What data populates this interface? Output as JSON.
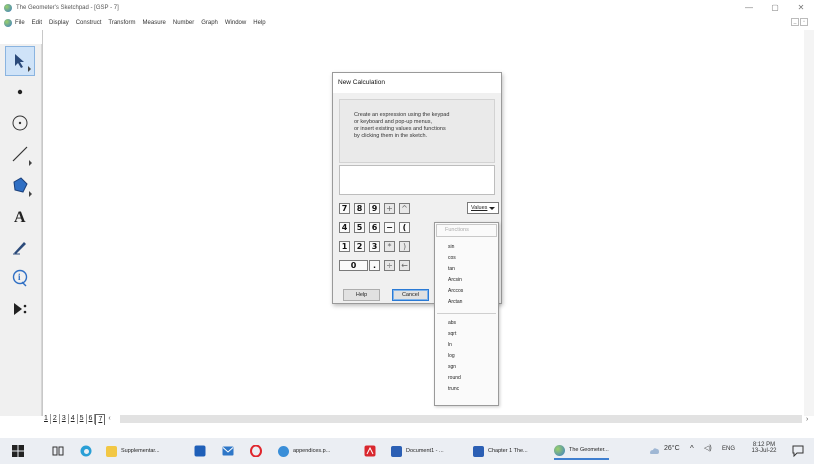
{
  "window": {
    "title": "The Geometer's Sketchpad - [GSP - 7]",
    "minimize": "—",
    "maximize": "▢",
    "close": "✕"
  },
  "menubar": {
    "items": [
      "File",
      "Edit",
      "Display",
      "Construct",
      "Transform",
      "Measure",
      "Number",
      "Graph",
      "Window",
      "Help"
    ]
  },
  "toolbox": {
    "tools": [
      "selection-arrow",
      "point",
      "compass",
      "straightedge",
      "polygon",
      "text",
      "marker",
      "information",
      "custom"
    ]
  },
  "dialog": {
    "title": "New Calculation",
    "instructions": [
      "Create an expression using the keypad",
      "or keyboard and pop-up menus,",
      "or insert existing values and functions",
      "by clicking them in the sketch."
    ],
    "keypad": {
      "row1": [
        "7",
        "8",
        "9",
        "+",
        "^"
      ],
      "row2": [
        "4",
        "5",
        "6",
        "−",
        "("
      ],
      "row3": [
        "1",
        "2",
        "3",
        "*",
        ")"
      ],
      "row4": [
        "0",
        ".",
        "÷",
        "←"
      ]
    },
    "values_label": "Values",
    "help_label": "Help",
    "cancel_label": "Cancel"
  },
  "functions_menu": {
    "header": "Functions",
    "group1": [
      "sin",
      "cos",
      "tan",
      "Arcsin",
      "Arccos",
      "Arctan"
    ],
    "group2": [
      "abs",
      "sqrt",
      "ln",
      "log",
      "sgn",
      "round",
      "trunc"
    ]
  },
  "pages": {
    "tabs": [
      "1",
      "2",
      "3",
      "4",
      "5",
      "6",
      "7"
    ],
    "current": "7"
  },
  "taskbar": {
    "apps": [
      {
        "label": "Supplementar...",
        "color": "#f2c744"
      },
      {
        "label": "appendices.p...",
        "color": "#3a8ed8"
      },
      {
        "label": "Document1 - ...",
        "color": "#2b5fb4"
      },
      {
        "label": "Chapter 1 The...",
        "color": "#2b5fb4"
      },
      {
        "label": "The Geometer...",
        "color": "#5aa0d8"
      }
    ],
    "temperature": "26°C",
    "language": "ENG",
    "time": "8:12 PM",
    "date": "13-Jul-22"
  }
}
